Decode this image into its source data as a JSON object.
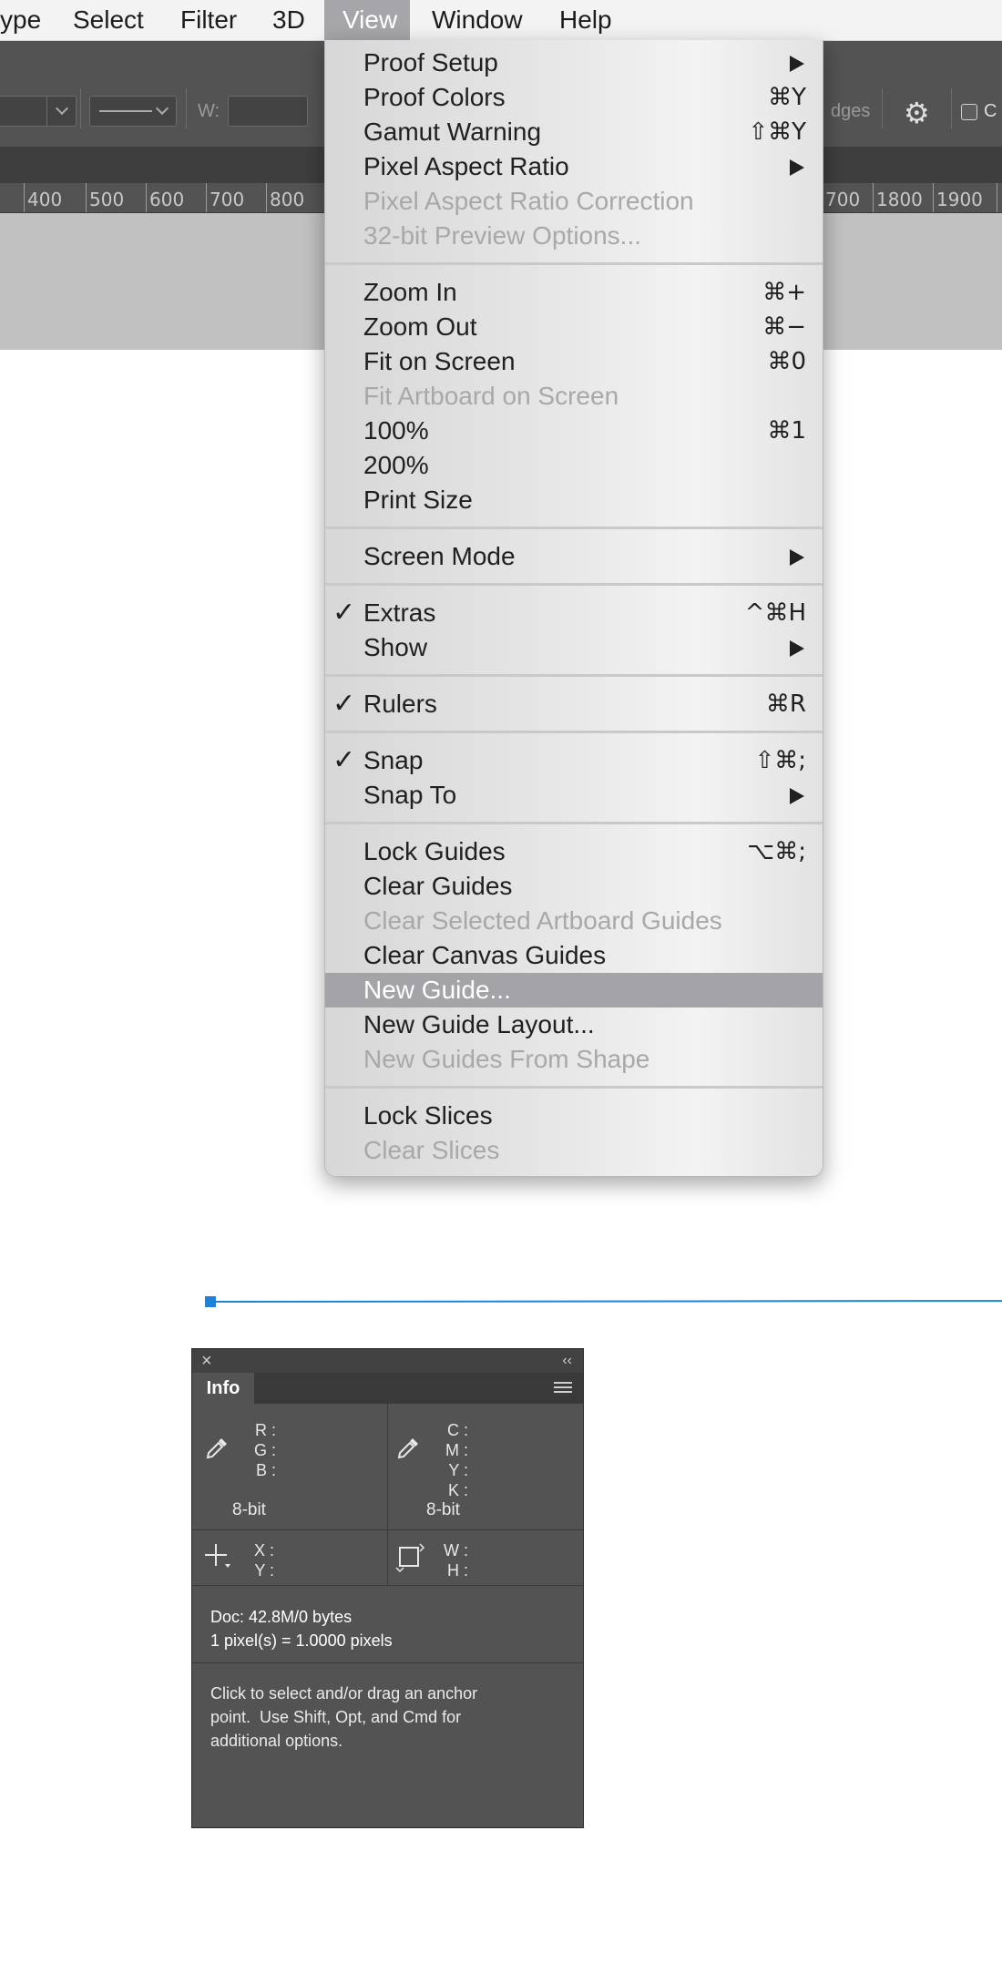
{
  "menubar": {
    "items": [
      "ype",
      "Select",
      "Filter",
      "3D",
      "View",
      "Window",
      "Help"
    ],
    "active": "View"
  },
  "options_bar": {
    "w_label": "W:",
    "edges_label": "dges",
    "checkbox_label": "C"
  },
  "ruler": {
    "left_labels": [
      "400",
      "500",
      "600",
      "700",
      "800"
    ],
    "right_labels": [
      "700",
      "1800",
      "1900"
    ]
  },
  "view_menu": {
    "items": [
      {
        "label": "Proof Setup",
        "shortcut": "",
        "submenu": true,
        "disabled": false,
        "checked": false
      },
      {
        "label": "Proof Colors",
        "shortcut": "⌘Y",
        "submenu": false,
        "disabled": false,
        "checked": false
      },
      {
        "label": "Gamut Warning",
        "shortcut": "⇧⌘Y",
        "submenu": false,
        "disabled": false,
        "checked": false
      },
      {
        "label": "Pixel Aspect Ratio",
        "shortcut": "",
        "submenu": true,
        "disabled": false,
        "checked": false
      },
      {
        "label": "Pixel Aspect Ratio Correction",
        "shortcut": "",
        "submenu": false,
        "disabled": true,
        "checked": false
      },
      {
        "label": "32-bit Preview Options...",
        "shortcut": "",
        "submenu": false,
        "disabled": true,
        "checked": false
      },
      {
        "label": "Zoom In",
        "shortcut": "⌘+",
        "submenu": false,
        "disabled": false,
        "checked": false
      },
      {
        "label": "Zoom Out",
        "shortcut": "⌘−",
        "submenu": false,
        "disabled": false,
        "checked": false
      },
      {
        "label": "Fit on Screen",
        "shortcut": "⌘0",
        "submenu": false,
        "disabled": false,
        "checked": false
      },
      {
        "label": "Fit Artboard on Screen",
        "shortcut": "",
        "submenu": false,
        "disabled": true,
        "checked": false
      },
      {
        "label": "100%",
        "shortcut": "⌘1",
        "submenu": false,
        "disabled": false,
        "checked": false
      },
      {
        "label": "200%",
        "shortcut": "",
        "submenu": false,
        "disabled": false,
        "checked": false
      },
      {
        "label": "Print Size",
        "shortcut": "",
        "submenu": false,
        "disabled": false,
        "checked": false
      },
      {
        "label": "Screen Mode",
        "shortcut": "",
        "submenu": true,
        "disabled": false,
        "checked": false
      },
      {
        "label": "Extras",
        "shortcut": "^⌘H",
        "submenu": false,
        "disabled": false,
        "checked": true
      },
      {
        "label": "Show",
        "shortcut": "",
        "submenu": true,
        "disabled": false,
        "checked": false
      },
      {
        "label": "Rulers",
        "shortcut": "⌘R",
        "submenu": false,
        "disabled": false,
        "checked": true
      },
      {
        "label": "Snap",
        "shortcut": "⇧⌘;",
        "submenu": false,
        "disabled": false,
        "checked": true
      },
      {
        "label": "Snap To",
        "shortcut": "",
        "submenu": true,
        "disabled": false,
        "checked": false
      },
      {
        "label": "Lock Guides",
        "shortcut": "⌥⌘;",
        "submenu": false,
        "disabled": false,
        "checked": false
      },
      {
        "label": "Clear Guides",
        "shortcut": "",
        "submenu": false,
        "disabled": false,
        "checked": false
      },
      {
        "label": "Clear Selected Artboard Guides",
        "shortcut": "",
        "submenu": false,
        "disabled": true,
        "checked": false
      },
      {
        "label": "Clear Canvas Guides",
        "shortcut": "",
        "submenu": false,
        "disabled": false,
        "checked": false
      },
      {
        "label": "New Guide...",
        "shortcut": "",
        "submenu": false,
        "disabled": false,
        "checked": false,
        "highlighted": true
      },
      {
        "label": "New Guide Layout...",
        "shortcut": "",
        "submenu": false,
        "disabled": false,
        "checked": false
      },
      {
        "label": "New Guides From Shape",
        "shortcut": "",
        "submenu": false,
        "disabled": true,
        "checked": false
      },
      {
        "label": "Lock Slices",
        "shortcut": "",
        "submenu": false,
        "disabled": false,
        "checked": false
      },
      {
        "label": "Clear Slices",
        "shortcut": "",
        "submenu": false,
        "disabled": true,
        "checked": false
      }
    ],
    "check_glyph": "✓"
  },
  "info_panel": {
    "close_glyph": "×",
    "collapse_glyph": "‹‹",
    "tab_label": "Info",
    "rgb_labels": "R :\nG :\nB :",
    "cmyk_labels": "C :\nM :\nY :\nK :",
    "left_bitdepth": "8-bit",
    "right_bitdepth": "8-bit",
    "xy_labels": "X :\nY :",
    "wh_labels": "W :\nH :",
    "doc_line": "Doc: 42.8M/0 bytes",
    "pixel_line": "1 pixel(s) = 1.0000 pixels",
    "hint_line1": "Click to select and/or drag an anchor",
    "hint_line2": "point.  Use Shift, Opt, and Cmd for",
    "hint_line3": "additional options."
  },
  "colors": {
    "menu_highlight": "#a3a3a8",
    "path_blue": "#1e83d8",
    "panel_bg": "#535353"
  }
}
